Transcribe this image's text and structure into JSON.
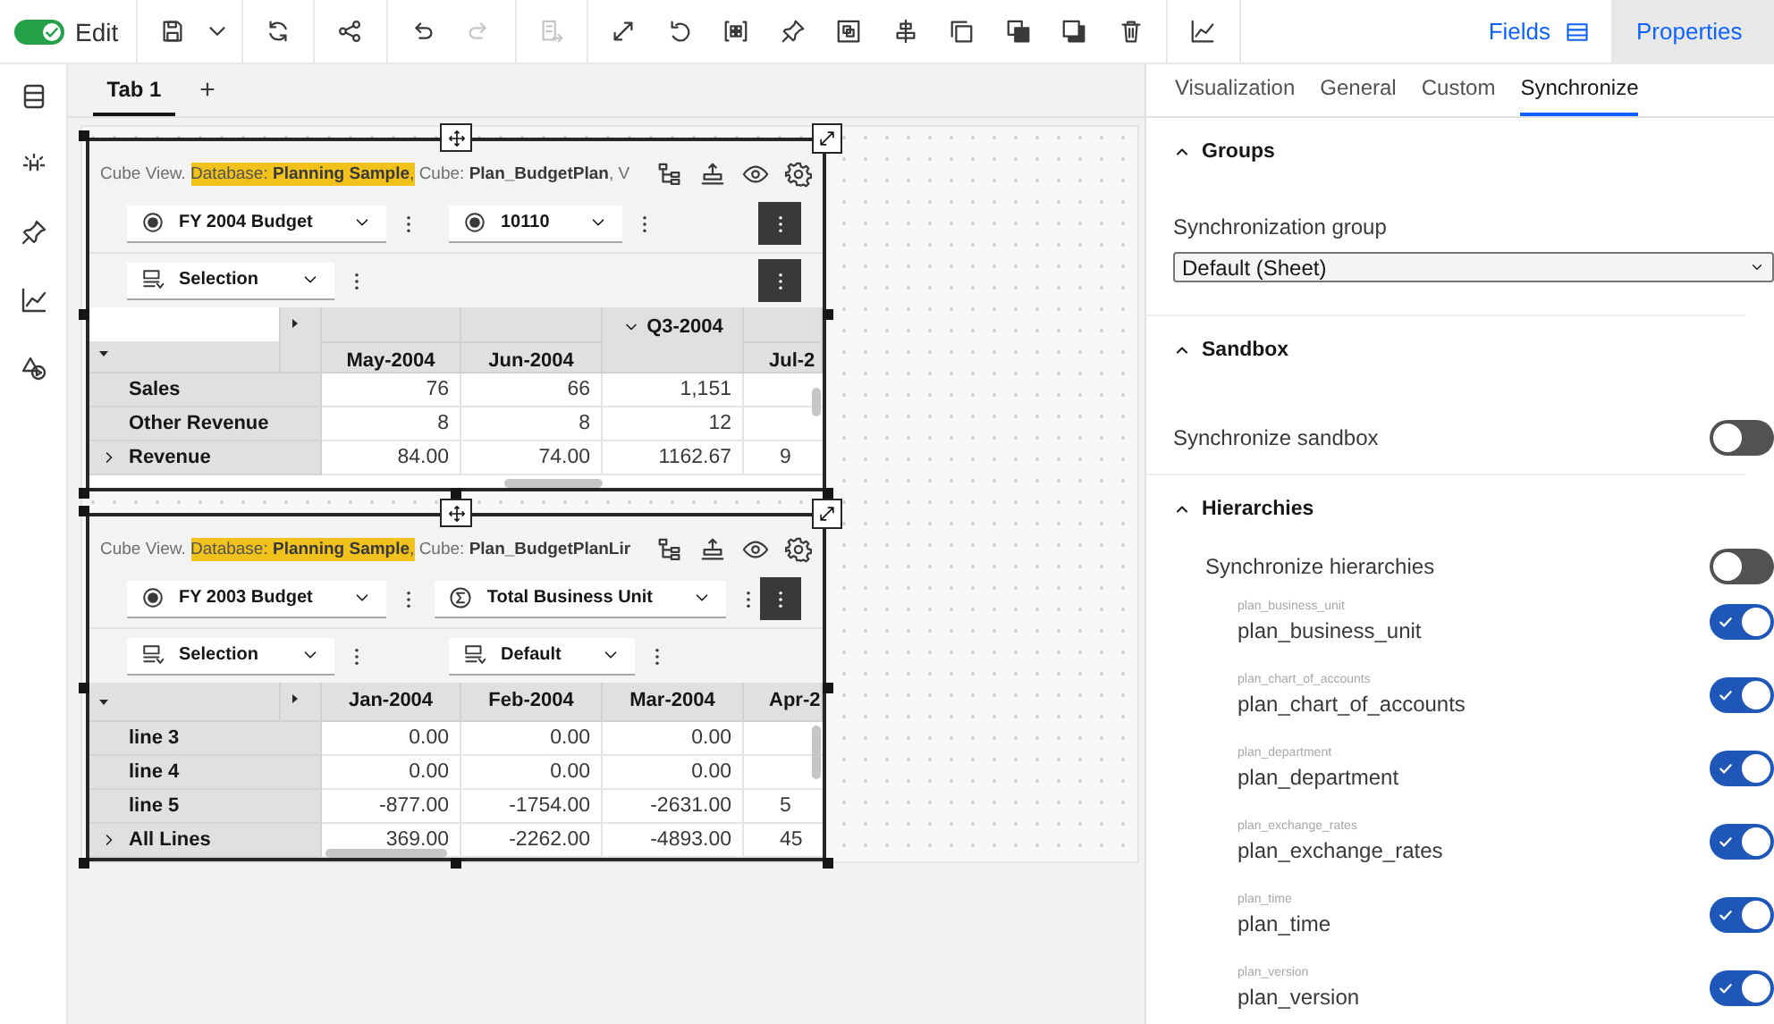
{
  "toolbar": {
    "edit": {
      "label": "Edit",
      "on": true
    },
    "groups": [
      [
        {
          "kind": "save",
          "disabled": false
        },
        {
          "kind": "caret",
          "disabled": false
        }
      ],
      [
        {
          "kind": "refresh",
          "disabled": false
        }
      ],
      [
        {
          "kind": "share",
          "disabled": false
        }
      ],
      [
        {
          "kind": "undo",
          "disabled": false
        },
        {
          "kind": "redo",
          "disabled": true
        }
      ],
      [
        {
          "kind": "lineage",
          "disabled": true
        }
      ],
      [
        {
          "kind": "expand",
          "disabled": false
        },
        {
          "kind": "rotate",
          "disabled": false
        },
        {
          "kind": "brackets",
          "disabled": false
        },
        {
          "kind": "pin",
          "disabled": false
        },
        {
          "kind": "frame",
          "disabled": false
        },
        {
          "kind": "align",
          "disabled": false
        },
        {
          "kind": "copy",
          "disabled": false
        },
        {
          "kind": "front",
          "disabled": false
        },
        {
          "kind": "back",
          "disabled": false
        },
        {
          "kind": "delete",
          "disabled": false
        }
      ],
      [
        {
          "kind": "chart",
          "disabled": false
        }
      ]
    ],
    "panels": [
      {
        "label": "Fields",
        "kind": "fields",
        "selected": false
      },
      {
        "label": "Properties",
        "kind": "properties",
        "selected": true
      }
    ]
  },
  "rail": [
    {
      "kind": "database"
    },
    {
      "kind": "bulb"
    },
    {
      "kind": "pin"
    },
    {
      "kind": "chart"
    },
    {
      "kind": "shapes"
    }
  ],
  "tabs": [
    {
      "label": "Tab 1",
      "selected": true
    }
  ],
  "add_tab": "+",
  "widgets": [
    {
      "title_prefix": "Cube View.",
      "title_highlight": "Database: **Planning Sample**,",
      "title_rest": "Cube: **Plan_BudgetPlan**, V",
      "context_rows": [
        {
          "menu_button": true,
          "selectors": [
            {
              "kind": "radio",
              "label": "FY 2004 Budget"
            },
            {
              "kind": "radio",
              "label": "10110"
            }
          ]
        },
        {
          "menu_button": true,
          "selectors": [
            {
              "kind": "list",
              "label": "Selection"
            }
          ]
        }
      ],
      "grid": {
        "kind": "stacked",
        "columns": [
          {
            "label": "May-2004",
            "kind": "member"
          },
          {
            "label": "Jun-2004",
            "kind": "member"
          },
          {
            "label": "Q3-2004",
            "kind": "parent"
          },
          {
            "label": "Jul-2",
            "kind": "member"
          }
        ],
        "rows": [
          {
            "label": "Sales",
            "expandable": false,
            "values": [
              "76",
              "66",
              "1,151"
            ]
          },
          {
            "label": "Other Revenue",
            "expandable": false,
            "values": [
              "8",
              "8",
              "12"
            ]
          },
          {
            "label": "Revenue",
            "expandable": true,
            "values": [
              "84.00",
              "74.00",
              "1162.67",
              "9"
            ]
          }
        ]
      }
    },
    {
      "title_prefix": "Cube View.",
      "title_highlight": "Database: **Planning Sample**,",
      "title_rest": "Cube: **Plan_BudgetPlanLir**",
      "context_rows": [
        {
          "menu_button": true,
          "selectors": [
            {
              "kind": "radio",
              "label": "FY 2003 Budget"
            },
            {
              "kind": "sigma",
              "label": "Total Business Unit"
            }
          ]
        },
        {
          "menu_button": false,
          "selectors": [
            {
              "kind": "list",
              "label": "Selection"
            },
            {
              "kind": "list",
              "label": "Default"
            }
          ]
        }
      ],
      "grid": {
        "kind": "flat",
        "columns": [
          {
            "label": "Jan-2004",
            "kind": "member"
          },
          {
            "label": "Feb-2004",
            "kind": "member"
          },
          {
            "label": "Mar-2004",
            "kind": "member"
          },
          {
            "label": "Apr-2",
            "kind": "member"
          }
        ],
        "rows": [
          {
            "label": "line 3",
            "expandable": false,
            "values": [
              "0.00",
              "0.00",
              "0.00"
            ]
          },
          {
            "label": "line 4",
            "expandable": false,
            "values": [
              "0.00",
              "0.00",
              "0.00"
            ]
          },
          {
            "label": "line 5",
            "expandable": false,
            "values": [
              "-877.00",
              "-1754.00",
              "-2631.00",
              "5"
            ]
          },
          {
            "label": "All Lines",
            "expandable": true,
            "values": [
              "369.00",
              "-2262.00",
              "-4893.00",
              "45"
            ]
          }
        ]
      }
    }
  ],
  "properties": {
    "tabs": [
      {
        "label": "Visualization",
        "selected": false
      },
      {
        "label": "General",
        "selected": false
      },
      {
        "label": "Custom",
        "selected": false
      },
      {
        "label": "Synchronize",
        "selected": true
      }
    ],
    "sections": [
      {
        "title": "Groups",
        "expanded": true,
        "kind": "select",
        "label": "Synchronization group",
        "value": "Default (Sheet)"
      },
      {
        "title": "Sandbox",
        "expanded": true,
        "kind": "toggle",
        "label": "Synchronize sandbox",
        "on": false
      },
      {
        "title": "Hierarchies",
        "expanded": true,
        "kind": "hierarchies",
        "label": "Synchronize hierarchies",
        "on": false,
        "items": [
          {
            "caption": "plan_business_unit",
            "name": "plan_business_unit",
            "on": true
          },
          {
            "caption": "plan_chart_of_accounts",
            "name": "plan_chart_of_accounts",
            "on": true
          },
          {
            "caption": "plan_department",
            "name": "plan_department",
            "on": true
          },
          {
            "caption": "plan_exchange_rates",
            "name": "plan_exchange_rates",
            "on": true
          },
          {
            "caption": "plan_time",
            "name": "plan_time",
            "on": true
          },
          {
            "caption": "plan_version",
            "name": "plan_version",
            "on": true
          }
        ]
      }
    ]
  }
}
